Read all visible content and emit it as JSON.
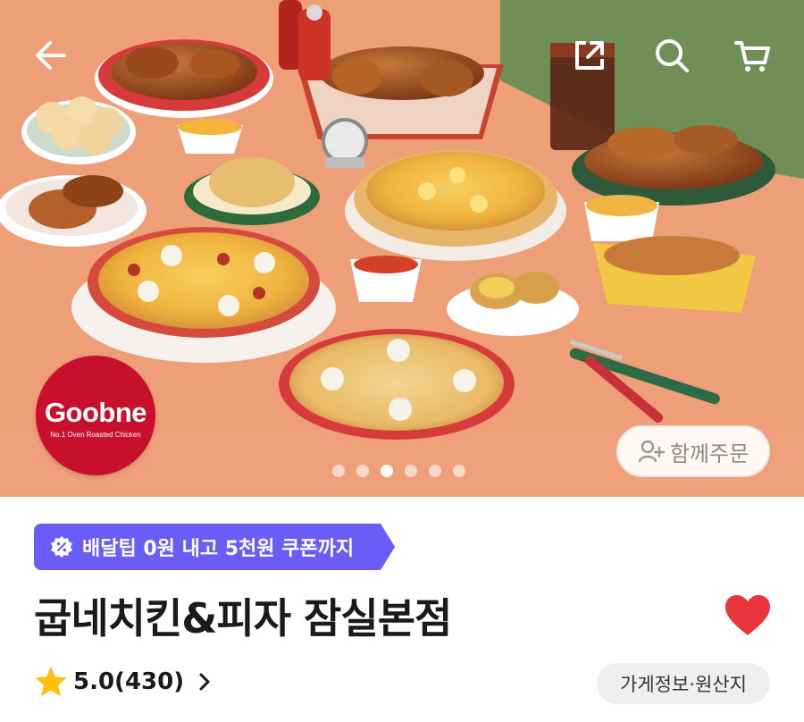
{
  "hero": {
    "brand_name": "Goobne",
    "brand_tagline": "No.1 Oven Roasted Chicken",
    "carousel_total": 6,
    "carousel_active": 3,
    "together_order_label": "함께주문"
  },
  "icons": {
    "back": "arrow-left-icon",
    "share": "share-icon",
    "search": "search-icon",
    "cart": "cart-icon",
    "together": "person-add-icon",
    "promo": "coupon-percent-icon",
    "favorite": "heart-icon",
    "rating": "star-icon",
    "more": "chevron-right-icon"
  },
  "colors": {
    "accent": "#6a5cf6",
    "heart": "#e8363c",
    "star": "#ffc107",
    "brand": "#c8102e"
  },
  "promo": {
    "label": "배달팁 0원 내고 5천원 쿠폰까지"
  },
  "store": {
    "name": "굽네치킨&피자 잠실본점",
    "is_favorite": true,
    "rating_text": "5.0(430)",
    "info_label": "가게정보·원산지"
  }
}
